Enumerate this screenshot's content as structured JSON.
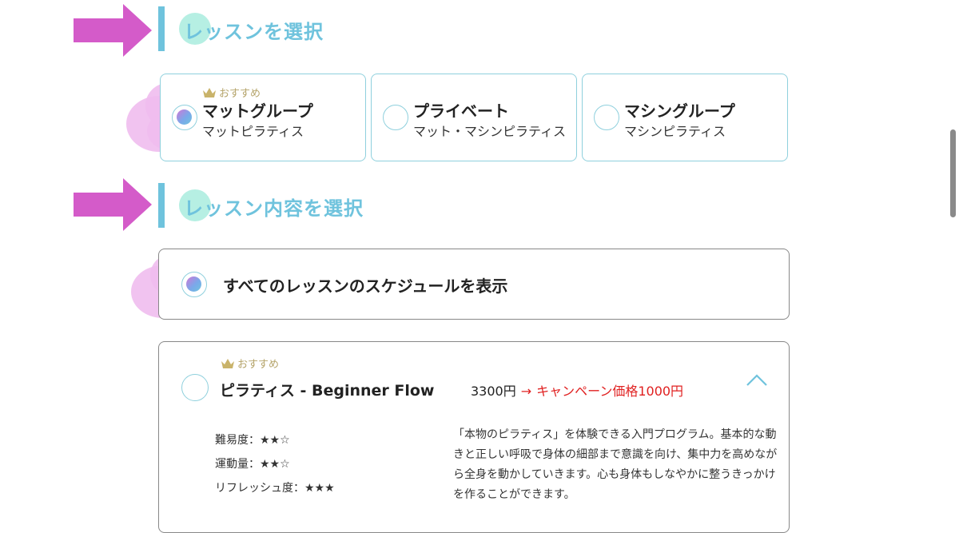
{
  "sections": {
    "lesson_select": {
      "title": "レッスンを選択"
    },
    "content_select": {
      "title": "レッスン内容を選択"
    }
  },
  "recommend_label": "おすすめ",
  "lesson_types": [
    {
      "name": "マットグループ",
      "sub": "マットピラティス",
      "selected": true,
      "recommended": true
    },
    {
      "name": "プライベート",
      "sub": "マット・マシンピラティス",
      "selected": false,
      "recommended": false
    },
    {
      "name": "マシングループ",
      "sub": "マシンピラティス",
      "selected": false,
      "recommended": false
    }
  ],
  "show_all": {
    "label": "すべてのレッスンのスケジュールを表示",
    "selected": true
  },
  "lesson": {
    "recommend": "おすすめ",
    "name": "ピラティス - Beginner Flow",
    "price": "3300円",
    "arrow": "→",
    "campaign": "キャンペーン価格1000円",
    "stats": [
      {
        "label": "難易度：★★☆"
      },
      {
        "label": "運動量：★★☆"
      },
      {
        "label": "リフレッシュ度：★★★"
      }
    ],
    "description": "「本物のピラティス」を体験できる入門プログラム。基本的な動きと正しい呼吸で身体の細部まで意識を向け、集中力を高めながら全身を動かしていきます。心も身体もしなやかに整うきっかけを作ることができます。"
  },
  "colors": {
    "accent": "#6fc3dd",
    "highlight": "#b6efe3",
    "pink": "#d45bc9",
    "recommend": "#b5a46a",
    "campaign": "#e02020"
  }
}
